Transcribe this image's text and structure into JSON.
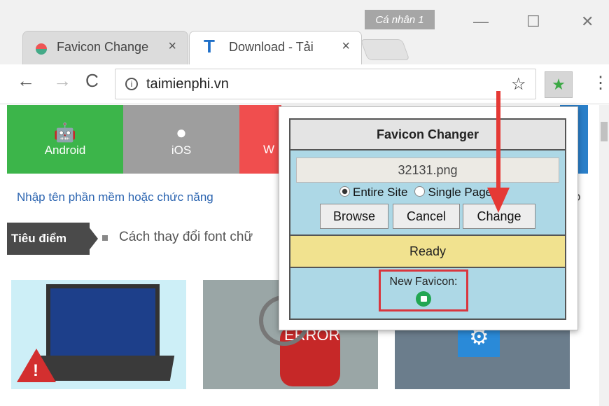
{
  "window": {
    "profile_label": "Cá nhân 1"
  },
  "tabs": [
    {
      "label": "Favicon Change"
    },
    {
      "label": "Download - Tải"
    }
  ],
  "toolbar": {
    "url": "taimienphi.vn"
  },
  "page": {
    "categories": [
      {
        "label": "Android",
        "color": "#3cb54a"
      },
      {
        "label": "iOS",
        "color": "#9e9e9e"
      },
      {
        "label": "W",
        "color": "#f04e4e"
      }
    ],
    "search_placeholder": "Nhập tên phần mềm hoặc chức năng",
    "featured_label": "Tiêu điểm",
    "headline": "Cách thay đổi font chữ",
    "thumb_text": "ERROR"
  },
  "popup": {
    "title": "Favicon Changer",
    "filename": "32131.png",
    "radio_entire": "Entire Site",
    "radio_single": "Single Page",
    "browse_label": "Browse",
    "cancel_label": "Cancel",
    "change_label": "Change",
    "status": "Ready",
    "new_favicon_label": "New Favicon:"
  },
  "colors": {
    "accent_red": "#d9363e",
    "panel_blue": "#add8e6",
    "status_yellow": "#f1e28f"
  }
}
